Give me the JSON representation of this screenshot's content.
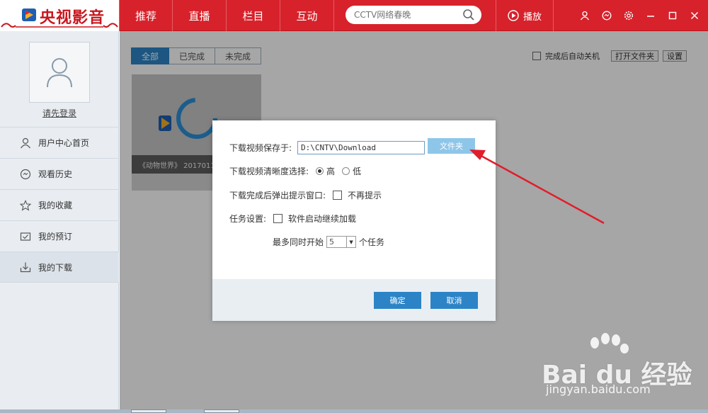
{
  "app": {
    "logo_text": "央视影音"
  },
  "nav": {
    "items": [
      "推荐",
      "直播",
      "栏目",
      "互动"
    ]
  },
  "search": {
    "placeholder": "CCTV网络春晚"
  },
  "header": {
    "play_label": "播放"
  },
  "sidebar": {
    "login_link": "请先登录",
    "items": [
      {
        "label": "用户中心首页",
        "icon": "user-icon"
      },
      {
        "label": "观看历史",
        "icon": "history-icon"
      },
      {
        "label": "我的收藏",
        "icon": "star-icon"
      },
      {
        "label": "我的预订",
        "icon": "reserve-icon"
      },
      {
        "label": "我的下载",
        "icon": "download-icon"
      }
    ]
  },
  "main": {
    "tabs": [
      "全部",
      "已完成",
      "未完成"
    ],
    "active_tab": "全部",
    "auto_shutdown_label": "完成后自动关机",
    "open_folder_label": "打开文件夹",
    "settings_label": "设置",
    "video": {
      "caption": "《动物世界》 20170112"
    }
  },
  "dialog": {
    "save_path_label": "下载视频保存于:",
    "save_path_value": "D:\\CNTV\\Download",
    "folder_button": "文件夹",
    "quality_label": "下载视频清晰度选择:",
    "quality_high": "高",
    "quality_low": "低",
    "popup_label": "下载完成后弹出提示窗口:",
    "popup_option": "不再提示",
    "task_label": "任务设置:",
    "task_option": "软件启动继续加载",
    "max_prefix": "最多同时开始",
    "max_value": "5",
    "max_suffix": "个任务",
    "ok_button": "确定",
    "cancel_button": "取消"
  },
  "watermark": {
    "brand": "Bai du 经验",
    "url": "jingyan.baidu.com"
  },
  "colors": {
    "brand_red": "#d7222b",
    "accent_blue": "#2c84c7",
    "folder_blue": "#8ec6ea",
    "arrow_red": "#e01d2a"
  }
}
